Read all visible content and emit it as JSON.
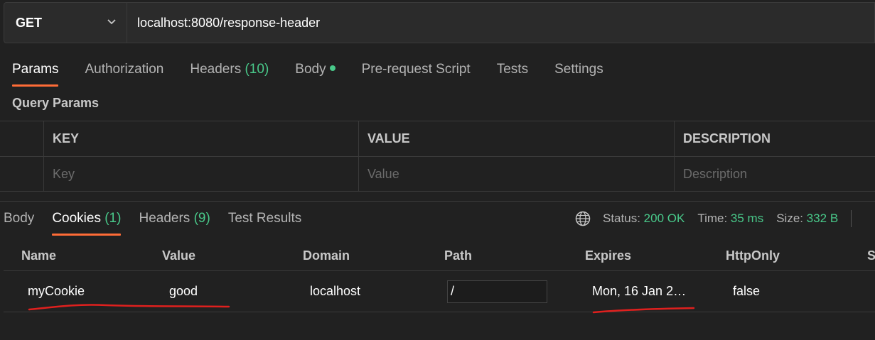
{
  "request": {
    "method": "GET",
    "url": "localhost:8080/response-header"
  },
  "request_tabs": [
    {
      "label": "Params",
      "active": true
    },
    {
      "label": "Authorization"
    },
    {
      "label": "Headers ",
      "count": "(10)"
    },
    {
      "label": "Body",
      "dot": true
    },
    {
      "label": "Pre-request Script"
    },
    {
      "label": "Tests"
    },
    {
      "label": "Settings"
    }
  ],
  "query_params": {
    "title": "Query Params",
    "columns": [
      "KEY",
      "VALUE",
      "DESCRIPTION"
    ],
    "placeholders": [
      "Key",
      "Value",
      "Description"
    ]
  },
  "response_tabs": [
    {
      "label": "Body"
    },
    {
      "label": "Cookies ",
      "count": "(1)",
      "active": true
    },
    {
      "label": "Headers ",
      "count": "(9)"
    },
    {
      "label": "Test Results"
    }
  ],
  "status": {
    "status_label": "Status:",
    "status_value": "200 OK",
    "time_label": "Time:",
    "time_value": "35 ms",
    "size_label": "Size:",
    "size_value": "332 B"
  },
  "cookies": {
    "columns": [
      "Name",
      "Value",
      "Domain",
      "Path",
      "Expires",
      "HttpOnly",
      "S"
    ],
    "rows": [
      {
        "name": "myCookie",
        "value": "good",
        "domain": "localhost",
        "path": "/",
        "expires": "Mon, 16 Jan 2…",
        "httponly": "false"
      }
    ]
  },
  "colors": {
    "accent": "#ff6c37",
    "success": "#49c98a",
    "annotation": "#e0201e"
  }
}
